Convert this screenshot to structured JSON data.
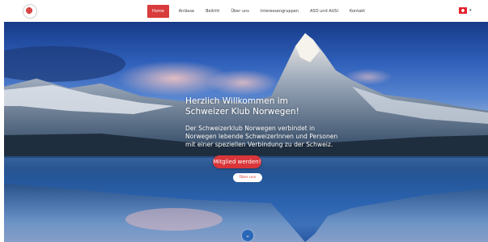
{
  "header": {
    "logo_name": "club-logo-icon",
    "nav": [
      {
        "label": "Home",
        "active": true
      },
      {
        "label": "Anlässe",
        "active": false
      },
      {
        "label": "Beitritt",
        "active": false
      },
      {
        "label": "Über uns",
        "active": false
      },
      {
        "label": "Interessengruppen",
        "active": false
      },
      {
        "label": "ASO und AUSI",
        "active": false
      },
      {
        "label": "Kontakt",
        "active": false
      }
    ],
    "language": {
      "icon": "swiss-flag-icon",
      "caret": "▾"
    }
  },
  "hero": {
    "title": "Herzlich Willkommen im Schweizer Klub Norwegen!",
    "body": "Der Schweizerklub Norwegen verbindet in Norwegen lebende SchweizerInnen und Personen mit einer speziellen Verbindung zu der Schweiz.",
    "primary_button": "Mitglied werden!",
    "secondary_button": "Über uns",
    "scroll_icon": "⌄"
  },
  "colors": {
    "accent": "#d83c3c",
    "nav_text": "#3d3d3d",
    "scroll_button": "#2a67b8"
  }
}
